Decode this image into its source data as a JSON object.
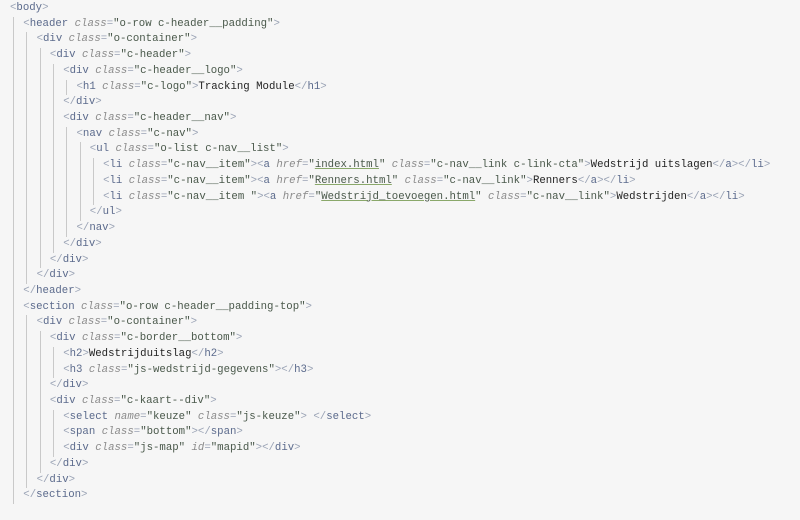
{
  "colors": {
    "background": "#f6f6f6",
    "tag": "#5b6a8c",
    "bracket": "#9aa3b5",
    "attribute": "#8b8b8b",
    "string": "#49584a",
    "text": "#222222",
    "link_underline": "#8aa86a"
  },
  "lines": [
    {
      "indent": 0,
      "tokens": [
        [
          "p",
          "<"
        ],
        [
          "g",
          "body"
        ],
        [
          "p",
          ">"
        ]
      ]
    },
    {
      "indent": 1,
      "tokens": [
        [
          "p",
          "<"
        ],
        [
          "g",
          "header "
        ],
        [
          "a",
          "class"
        ],
        [
          "p",
          "="
        ],
        [
          "s",
          "\"o-row c-header__padding\""
        ],
        [
          "p",
          ">"
        ]
      ]
    },
    {
      "indent": 2,
      "tokens": [
        [
          "p",
          "<"
        ],
        [
          "g",
          "div "
        ],
        [
          "a",
          "class"
        ],
        [
          "p",
          "="
        ],
        [
          "s",
          "\"o-container\""
        ],
        [
          "p",
          ">"
        ]
      ]
    },
    {
      "indent": 3,
      "tokens": [
        [
          "p",
          "<"
        ],
        [
          "g",
          "div "
        ],
        [
          "a",
          "class"
        ],
        [
          "p",
          "="
        ],
        [
          "s",
          "\"c-header\""
        ],
        [
          "p",
          ">"
        ]
      ]
    },
    {
      "indent": 4,
      "tokens": [
        [
          "p",
          "<"
        ],
        [
          "g",
          "div "
        ],
        [
          "a",
          "class"
        ],
        [
          "p",
          "="
        ],
        [
          "s",
          "\"c-header__logo\""
        ],
        [
          "p",
          ">"
        ]
      ]
    },
    {
      "indent": 5,
      "tokens": [
        [
          "p",
          "<"
        ],
        [
          "g",
          "h1 "
        ],
        [
          "a",
          "class"
        ],
        [
          "p",
          "="
        ],
        [
          "s",
          "\"c-logo\""
        ],
        [
          "p",
          ">"
        ],
        [
          "x",
          "Tracking Module"
        ],
        [
          "p",
          "</"
        ],
        [
          "g",
          "h1"
        ],
        [
          "p",
          ">"
        ]
      ]
    },
    {
      "indent": 4,
      "tokens": [
        [
          "p",
          "</"
        ],
        [
          "g",
          "div"
        ],
        [
          "p",
          ">"
        ]
      ]
    },
    {
      "indent": 4,
      "tokens": [
        [
          "p",
          "<"
        ],
        [
          "g",
          "div "
        ],
        [
          "a",
          "class"
        ],
        [
          "p",
          "="
        ],
        [
          "s",
          "\"c-header__nav\""
        ],
        [
          "p",
          ">"
        ]
      ]
    },
    {
      "indent": 5,
      "tokens": [
        [
          "p",
          "<"
        ],
        [
          "g",
          "nav "
        ],
        [
          "a",
          "class"
        ],
        [
          "p",
          "="
        ],
        [
          "s",
          "\"c-nav\""
        ],
        [
          "p",
          ">"
        ]
      ]
    },
    {
      "indent": 6,
      "tokens": [
        [
          "p",
          "<"
        ],
        [
          "g",
          "ul "
        ],
        [
          "a",
          "class"
        ],
        [
          "p",
          "="
        ],
        [
          "s",
          "\"o-list c-nav__list\""
        ],
        [
          "p",
          ">"
        ]
      ]
    },
    {
      "indent": 7,
      "tokens": [
        [
          "p",
          "<"
        ],
        [
          "g",
          "li "
        ],
        [
          "a",
          "class"
        ],
        [
          "p",
          "="
        ],
        [
          "s",
          "\"c-nav__item\""
        ],
        [
          "p",
          ">"
        ],
        [
          "p",
          "<"
        ],
        [
          "g",
          "a "
        ],
        [
          "a",
          "href"
        ],
        [
          "p",
          "="
        ],
        [
          "s",
          "\""
        ],
        [
          "l",
          "index.html"
        ],
        [
          "s",
          "\" "
        ],
        [
          "a",
          "class"
        ],
        [
          "p",
          "="
        ],
        [
          "s",
          "\"c-nav__link c-link-cta\""
        ],
        [
          "p",
          ">"
        ],
        [
          "x",
          "Wedstrijd uitslagen"
        ],
        [
          "p",
          "</"
        ],
        [
          "g",
          "a"
        ],
        [
          "p",
          "></"
        ],
        [
          "g",
          "li"
        ],
        [
          "p",
          ">"
        ]
      ]
    },
    {
      "indent": 7,
      "tokens": [
        [
          "p",
          "<"
        ],
        [
          "g",
          "li "
        ],
        [
          "a",
          "class"
        ],
        [
          "p",
          "="
        ],
        [
          "s",
          "\"c-nav__item\""
        ],
        [
          "p",
          ">"
        ],
        [
          "p",
          "<"
        ],
        [
          "g",
          "a "
        ],
        [
          "a",
          "href"
        ],
        [
          "p",
          "="
        ],
        [
          "s",
          "\""
        ],
        [
          "l",
          "Renners.html"
        ],
        [
          "s",
          "\" "
        ],
        [
          "a",
          "class"
        ],
        [
          "p",
          "="
        ],
        [
          "s",
          "\"c-nav__link\""
        ],
        [
          "p",
          ">"
        ],
        [
          "x",
          "Renners"
        ],
        [
          "p",
          "</"
        ],
        [
          "g",
          "a"
        ],
        [
          "p",
          "></"
        ],
        [
          "g",
          "li"
        ],
        [
          "p",
          ">"
        ]
      ]
    },
    {
      "indent": 7,
      "tokens": [
        [
          "p",
          "<"
        ],
        [
          "g",
          "li "
        ],
        [
          "a",
          "class"
        ],
        [
          "p",
          "="
        ],
        [
          "s",
          "\"c-nav__item \""
        ],
        [
          "p",
          ">"
        ],
        [
          "p",
          "<"
        ],
        [
          "g",
          "a "
        ],
        [
          "a",
          "href"
        ],
        [
          "p",
          "="
        ],
        [
          "s",
          "\""
        ],
        [
          "l",
          "Wedstrijd_toevoegen.html"
        ],
        [
          "s",
          "\" "
        ],
        [
          "a",
          "class"
        ],
        [
          "p",
          "="
        ],
        [
          "s",
          "\"c-nav__link\""
        ],
        [
          "p",
          ">"
        ],
        [
          "x",
          "Wedstrijden"
        ],
        [
          "p",
          "</"
        ],
        [
          "g",
          "a"
        ],
        [
          "p",
          "></"
        ],
        [
          "g",
          "li"
        ],
        [
          "p",
          ">"
        ]
      ]
    },
    {
      "indent": 6,
      "tokens": [
        [
          "p",
          "</"
        ],
        [
          "g",
          "ul"
        ],
        [
          "p",
          ">"
        ]
      ]
    },
    {
      "indent": 5,
      "tokens": [
        [
          "p",
          "</"
        ],
        [
          "g",
          "nav"
        ],
        [
          "p",
          ">"
        ]
      ]
    },
    {
      "indent": 4,
      "tokens": [
        [
          "p",
          "</"
        ],
        [
          "g",
          "div"
        ],
        [
          "p",
          ">"
        ]
      ]
    },
    {
      "indent": 3,
      "tokens": [
        [
          "p",
          "</"
        ],
        [
          "g",
          "div"
        ],
        [
          "p",
          ">"
        ]
      ]
    },
    {
      "indent": 2,
      "tokens": [
        [
          "p",
          "</"
        ],
        [
          "g",
          "div"
        ],
        [
          "p",
          ">"
        ]
      ]
    },
    {
      "indent": 1,
      "tokens": [
        [
          "p",
          "</"
        ],
        [
          "g",
          "header"
        ],
        [
          "p",
          ">"
        ]
      ]
    },
    {
      "indent": 1,
      "tokens": [
        [
          "p",
          "<"
        ],
        [
          "g",
          "section "
        ],
        [
          "a",
          "class"
        ],
        [
          "p",
          "="
        ],
        [
          "s",
          "\"o-row c-header__padding-top\""
        ],
        [
          "p",
          ">"
        ]
      ]
    },
    {
      "indent": 2,
      "tokens": [
        [
          "p",
          "<"
        ],
        [
          "g",
          "div "
        ],
        [
          "a",
          "class"
        ],
        [
          "p",
          "="
        ],
        [
          "s",
          "\"o-container\""
        ],
        [
          "p",
          ">"
        ]
      ]
    },
    {
      "indent": 3,
      "tokens": [
        [
          "p",
          "<"
        ],
        [
          "g",
          "div "
        ],
        [
          "a",
          "class"
        ],
        [
          "p",
          "="
        ],
        [
          "s",
          "\"c-border__bottom\""
        ],
        [
          "p",
          ">"
        ]
      ]
    },
    {
      "indent": 4,
      "tokens": [
        [
          "p",
          "<"
        ],
        [
          "g",
          "h2"
        ],
        [
          "p",
          ">"
        ],
        [
          "x",
          "Wedstrijduitslag"
        ],
        [
          "p",
          "</"
        ],
        [
          "g",
          "h2"
        ],
        [
          "p",
          ">"
        ]
      ]
    },
    {
      "indent": 4,
      "tokens": [
        [
          "p",
          "<"
        ],
        [
          "g",
          "h3 "
        ],
        [
          "a",
          "class"
        ],
        [
          "p",
          "="
        ],
        [
          "s",
          "\"js-wedstrijd-gegevens\""
        ],
        [
          "p",
          ">"
        ],
        [
          "p",
          "</"
        ],
        [
          "g",
          "h3"
        ],
        [
          "p",
          ">"
        ]
      ]
    },
    {
      "indent": 3,
      "tokens": [
        [
          "p",
          "</"
        ],
        [
          "g",
          "div"
        ],
        [
          "p",
          ">"
        ]
      ]
    },
    {
      "indent": 3,
      "tokens": [
        [
          "p",
          "<"
        ],
        [
          "g",
          "div "
        ],
        [
          "a",
          "class"
        ],
        [
          "p",
          "="
        ],
        [
          "s",
          "\"c-kaart--div\""
        ],
        [
          "p",
          ">"
        ]
      ]
    },
    {
      "indent": 4,
      "tokens": [
        [
          "p",
          "<"
        ],
        [
          "g",
          "select "
        ],
        [
          "a",
          "name"
        ],
        [
          "p",
          "="
        ],
        [
          "s",
          "\"keuze\" "
        ],
        [
          "a",
          "class"
        ],
        [
          "p",
          "="
        ],
        [
          "s",
          "\"js-keuze\""
        ],
        [
          "p",
          "> </"
        ],
        [
          "g",
          "select"
        ],
        [
          "p",
          ">"
        ]
      ]
    },
    {
      "indent": 4,
      "tokens": [
        [
          "p",
          "<"
        ],
        [
          "g",
          "span "
        ],
        [
          "a",
          "class"
        ],
        [
          "p",
          "="
        ],
        [
          "s",
          "\"bottom\""
        ],
        [
          "p",
          ">"
        ],
        [
          "p",
          "</"
        ],
        [
          "g",
          "span"
        ],
        [
          "p",
          ">"
        ]
      ]
    },
    {
      "indent": 4,
      "tokens": [
        [
          "p",
          "<"
        ],
        [
          "g",
          "div "
        ],
        [
          "a",
          "class"
        ],
        [
          "p",
          "="
        ],
        [
          "s",
          "\"js-map\" "
        ],
        [
          "a",
          "id"
        ],
        [
          "p",
          "="
        ],
        [
          "s",
          "\"mapid\""
        ],
        [
          "p",
          ">"
        ],
        [
          "p",
          "</"
        ],
        [
          "g",
          "div"
        ],
        [
          "p",
          ">"
        ]
      ]
    },
    {
      "indent": 3,
      "tokens": [
        [
          "p",
          "</"
        ],
        [
          "g",
          "div"
        ],
        [
          "p",
          ">"
        ]
      ]
    },
    {
      "indent": 2,
      "tokens": [
        [
          "p",
          "</"
        ],
        [
          "g",
          "div"
        ],
        [
          "p",
          ">"
        ]
      ]
    },
    {
      "indent": 1,
      "tokens": [
        [
          "p",
          "</"
        ],
        [
          "g",
          "section"
        ],
        [
          "p",
          ">"
        ]
      ]
    }
  ]
}
